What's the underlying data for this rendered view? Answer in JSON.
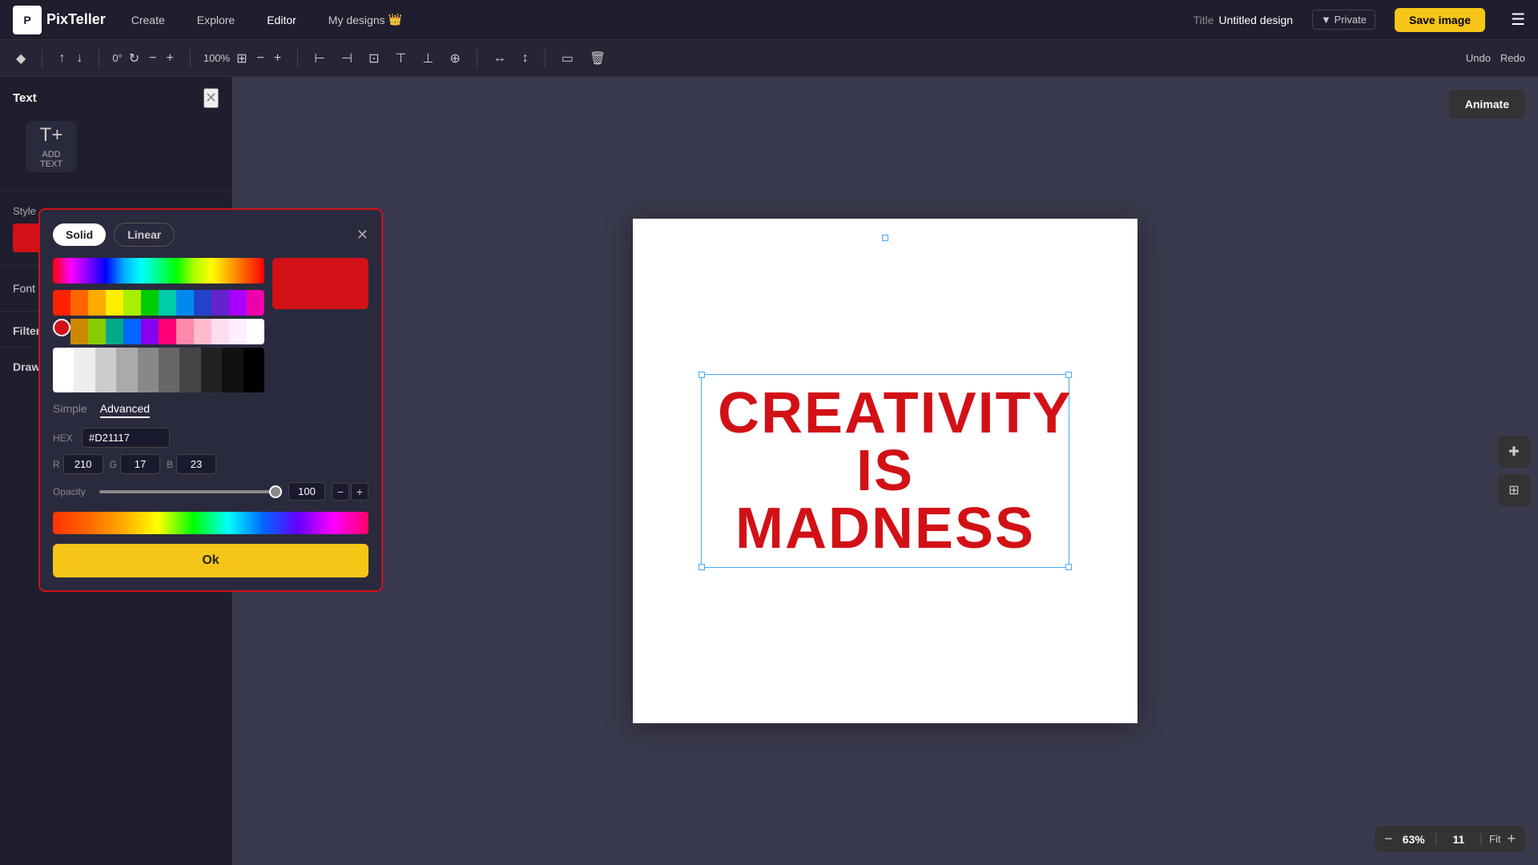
{
  "app": {
    "logo_letter": "P",
    "logo_text": "PixTeller"
  },
  "nav": {
    "create": "Create",
    "explore": "Explore",
    "editor": "Editor",
    "mydesigns": "My designs"
  },
  "title_area": {
    "label": "Title",
    "value": "Untitled design"
  },
  "private_label": "▼ Private",
  "save_label": "Save image",
  "toolbar": {
    "rotation": "0°",
    "zoom": "100%",
    "undo": "Undo",
    "redo": "Redo"
  },
  "left_panel": {
    "section_title": "Text",
    "add_text_label": "ADD\nTEXT",
    "style_label": "Style",
    "font_label": "Font",
    "filters_label": "Filters",
    "drawing_label": "Drawing"
  },
  "color_picker": {
    "tab_solid": "Solid",
    "tab_linear": "Linear",
    "mode_simple": "Simple",
    "mode_advanced": "Advanced",
    "hex_label": "HEX",
    "hex_value": "#D21117",
    "r_label": "R",
    "r_value": "210",
    "g_label": "G",
    "g_value": "17",
    "b_label": "B",
    "b_value": "23",
    "opacity_label": "Opacity",
    "opacity_value": "100",
    "ok_label": "Ok"
  },
  "canvas": {
    "text_line1": "CREATIVITY",
    "text_line2": "IS MADNESS",
    "text_color": "#D21117"
  },
  "zoom_bar": {
    "minus": "−",
    "value": "63%",
    "num2": "11",
    "fit": "Fit",
    "plus": "+"
  },
  "animate_btn": "Animate"
}
